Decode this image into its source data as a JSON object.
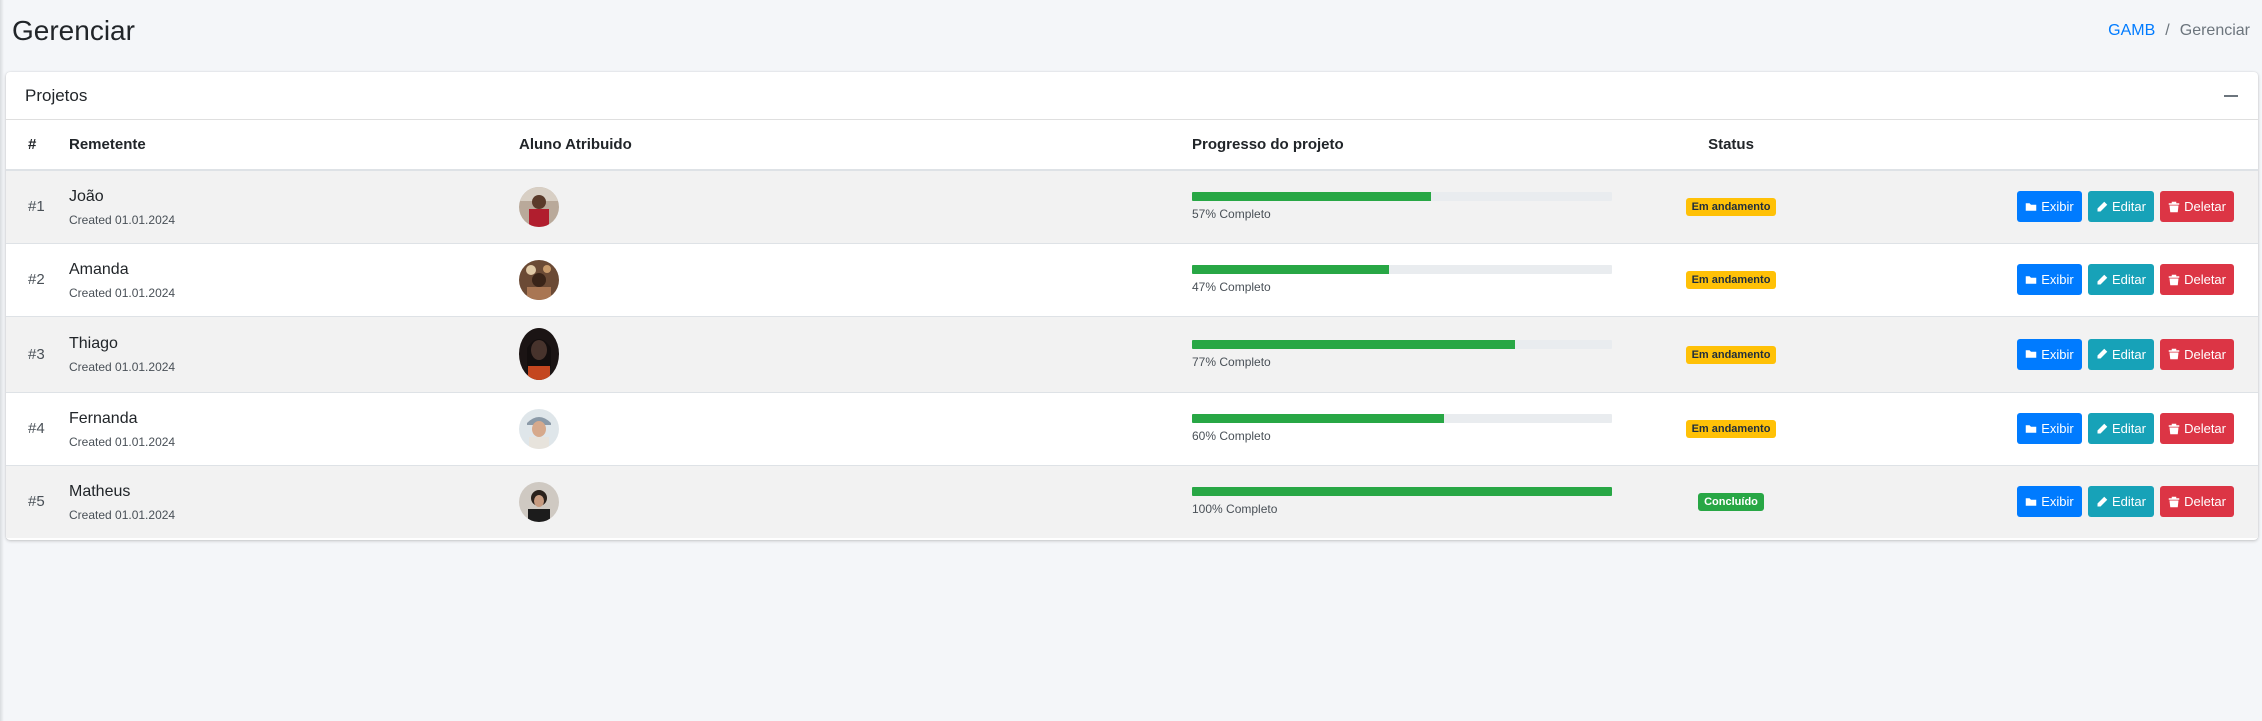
{
  "header": {
    "title": "Gerenciar",
    "breadcrumb": {
      "home": "GAMB",
      "separator": "/",
      "current": "Gerenciar"
    }
  },
  "card": {
    "title": "Projetos",
    "columns": [
      "#",
      "Remetente",
      "Aluno Atribuido",
      "Progresso do projeto",
      "Status",
      ""
    ]
  },
  "actions": {
    "view": "Exibir",
    "edit": "Editar",
    "delete": "Deletar"
  },
  "rows": [
    {
      "num": "#1",
      "name": "João",
      "created": "Created 01.01.2024",
      "progress": 57,
      "progress_text": "57% Completo",
      "status": "Em andamento",
      "status_type": "warning"
    },
    {
      "num": "#2",
      "name": "Amanda",
      "created": "Created 01.01.2024",
      "progress": 47,
      "progress_text": "47% Completo",
      "status": "Em andamento",
      "status_type": "warning"
    },
    {
      "num": "#3",
      "name": "Thiago",
      "created": "Created 01.01.2024",
      "progress": 77,
      "progress_text": "77% Completo",
      "status": "Em andamento",
      "status_type": "warning"
    },
    {
      "num": "#4",
      "name": "Fernanda",
      "created": "Created 01.01.2024",
      "progress": 60,
      "progress_text": "60% Completo",
      "status": "Em andamento",
      "status_type": "warning"
    },
    {
      "num": "#5",
      "name": "Matheus",
      "created": "Created 01.01.2024",
      "progress": 100,
      "progress_text": "100% Completo",
      "status": "Concluído",
      "status_type": "success"
    }
  ],
  "colors": {
    "primary": "#007bff",
    "info": "#17a2b8",
    "danger": "#dc3545",
    "success": "#28a745",
    "warning": "#ffc107"
  },
  "icons": {
    "view": "folder-icon",
    "edit": "pencil-icon",
    "delete": "trash-icon",
    "collapse": "minus-icon"
  }
}
